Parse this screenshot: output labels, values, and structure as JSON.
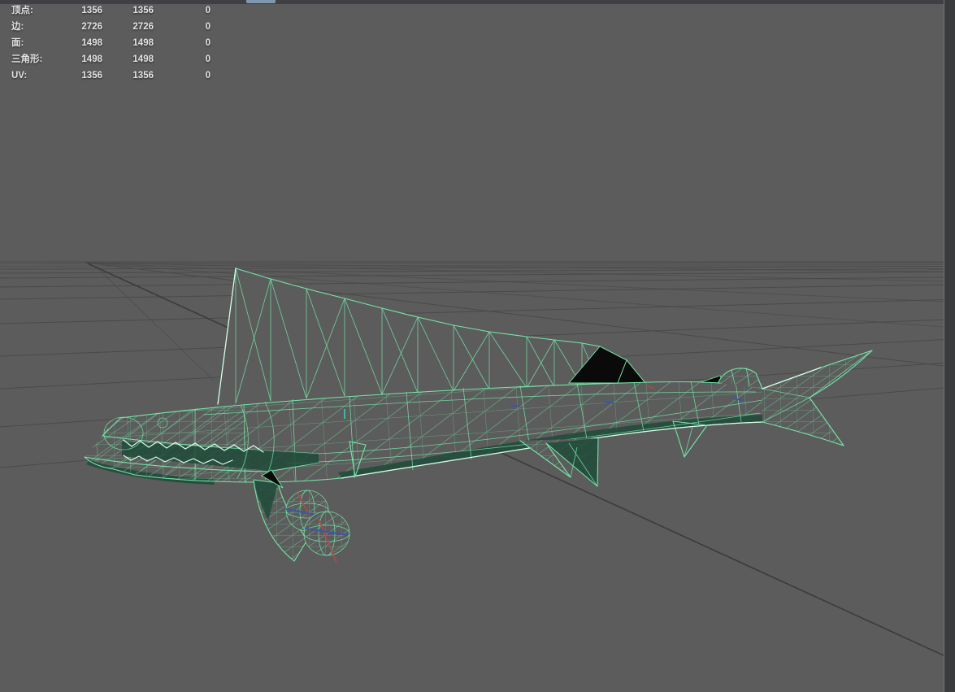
{
  "hud": {
    "rows": [
      {
        "label": "顶点:",
        "col1": "1356",
        "col2": "1356",
        "col3": "0"
      },
      {
        "label": "边:",
        "col1": "2726",
        "col2": "2726",
        "col3": "0"
      },
      {
        "label": "面:",
        "col1": "1498",
        "col2": "1498",
        "col3": "0"
      },
      {
        "label": "三角形:",
        "col1": "1498",
        "col2": "1498",
        "col3": "0"
      },
      {
        "label": "UV:",
        "col1": "1356",
        "col2": "1356",
        "col3": "0"
      }
    ]
  },
  "colors": {
    "bg": "#5c5c5c",
    "grid": "#4a4a4a",
    "grid-light": "#525252",
    "grid-dark": "#3b3b3b",
    "wire": "#74e6a8",
    "wire-bright": "#d9ffe9",
    "fill-teal": "#1f4a39",
    "fill-black": "#0a0a0a",
    "hud-text": "#e2e2e2",
    "top-strip": "#3e4043",
    "top-accent": "#8097ae",
    "edge-strip": "#3a3b3c",
    "edge-light": "#707274",
    "axis-red": "#b04a4a",
    "axis-blue": "#3a57a8",
    "tick-cyan": "#35dcb4"
  }
}
